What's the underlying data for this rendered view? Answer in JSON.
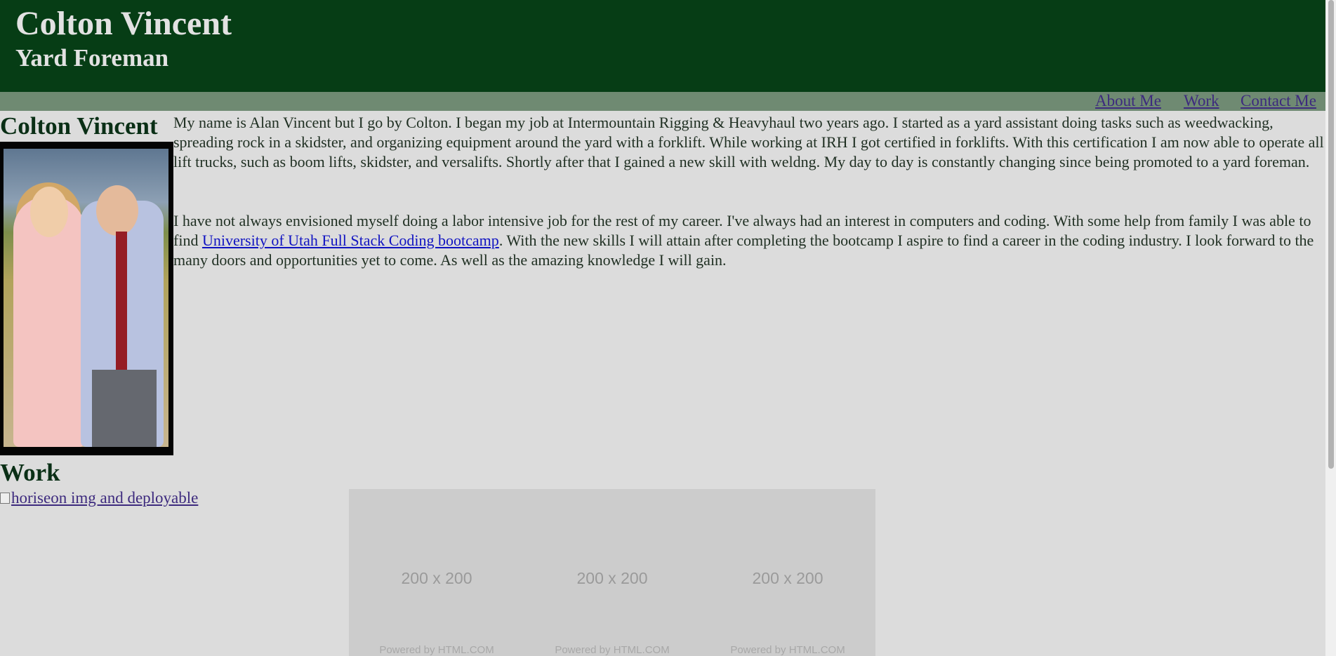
{
  "header": {
    "name": "Colton Vincent",
    "title": "Yard Foreman",
    "colors": {
      "background": "#063d15",
      "nav": "#6f8a72",
      "page": "#dcdcdc"
    }
  },
  "nav": {
    "items": [
      {
        "label": "About Me"
      },
      {
        "label": "Work"
      },
      {
        "label": "Contact Me"
      }
    ]
  },
  "about": {
    "heading": "Colton Vincent",
    "paragraph1": "My name is Alan Vincent but I go by Colton. I began my job at Intermountain Rigging & Heavyhaul two years ago. I started as a yard assistant doing tasks such as weedwacking, spreading rock in a skidster, and organizing equipment around the yard with a forklift. While working at IRH I got certified in forklifts. With this certification I am now able to operate all lift trucks, such as boom lifts, skidster, and versalifts. Shortly after that I gained a new skill with weldng. My day to day is constantly changing since being promoted to a yard foreman.",
    "paragraph2_before_link": "I have not always envisioned myself doing a labor intensive job for the rest of my career. I've always had an interest in computers and coding. With some help from family I was able to find ",
    "paragraph2_link": "University of Utah Full Stack Coding bootcamp",
    "paragraph2_after_link": ". With the new skills I will attain after completing the bootcamp I aspire to find a career in the coding industry. I look forward to the many doors and opportunities yet to come. As well as the amazing knowledge I will gain.",
    "photo_icon": "portrait-photo"
  },
  "work": {
    "heading": "Work",
    "broken_image_alt": "horiseon img and deployable",
    "placeholders": [
      {
        "size": "200 x 200",
        "powered": "Powered by HTML.COM"
      },
      {
        "size": "200 x 200",
        "powered": "Powered by HTML.COM"
      },
      {
        "size": "200 x 200",
        "powered": "Powered by HTML.COM"
      }
    ]
  }
}
